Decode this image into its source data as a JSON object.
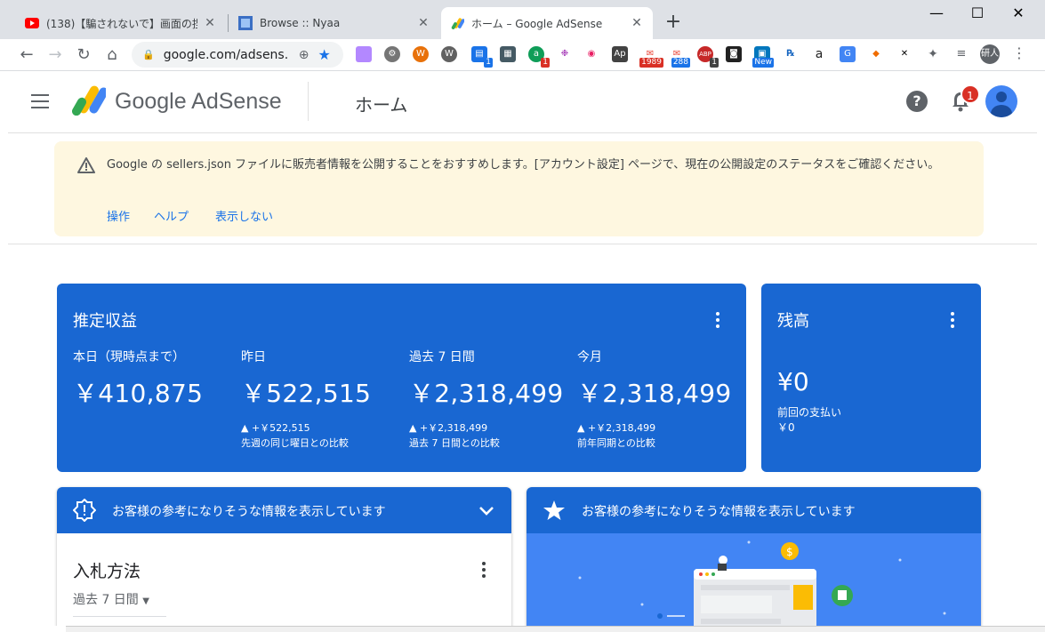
{
  "browser": {
    "tabs": [
      {
        "title": "(138)【騙されないで】画面の捏造ち",
        "icon": "youtube-icon"
      },
      {
        "title": "Browse :: Nyaa",
        "icon": "nyaa-icon"
      },
      {
        "title": "ホーム – Google AdSense",
        "icon": "adsense-icon"
      }
    ],
    "url": "google.com/adsens...",
    "profile_label": "研人",
    "extension_badges": {
      "ext5": "1",
      "ext7": "1",
      "gmail1": "1989",
      "gmail2": "288",
      "abp": "1",
      "news": "New"
    }
  },
  "header": {
    "logo_text": "Google AdSense",
    "page_title": "ホーム",
    "notification_count": "1"
  },
  "notice": {
    "message": "Google の sellers.json ファイルに販売者情報を公開することをおすすめします。[アカウント設定] ページで、現在の公開設定のステータスをご確認ください。",
    "actions": [
      "操作",
      "ヘルプ",
      "表示しない"
    ]
  },
  "earnings": {
    "title": "推定収益",
    "metrics": [
      {
        "label": "本日（現時点まで）",
        "value": "￥410,875",
        "change": "",
        "compare": ""
      },
      {
        "label": "昨日",
        "value": "￥522,515",
        "change": "▲ +￥522,515",
        "compare": "先週の同じ曜日との比較"
      },
      {
        "label": "過去 7 日間",
        "value": "￥2,318,499",
        "change": "▲ +￥2,318,499",
        "compare": "過去 7 日間との比較"
      },
      {
        "label": "今月",
        "value": "￥2,318,499",
        "change": "▲ +￥2,318,499",
        "compare": "前年同期との比較"
      }
    ]
  },
  "balance": {
    "title": "残高",
    "value": "¥0",
    "last_payment_label": "前回の支払い",
    "last_payment_value": "￥0"
  },
  "info_left": {
    "bar_text": "お客様の参考になりそうな情報を表示しています",
    "title": "入札方法",
    "range": "過去 7 日間"
  },
  "info_right": {
    "bar_text": "お客様の参考になりそうな情報を表示しています"
  },
  "colors": {
    "card_blue": "#1967d2",
    "notice_bg": "#fef7e0",
    "link_blue": "#1a73e8"
  }
}
